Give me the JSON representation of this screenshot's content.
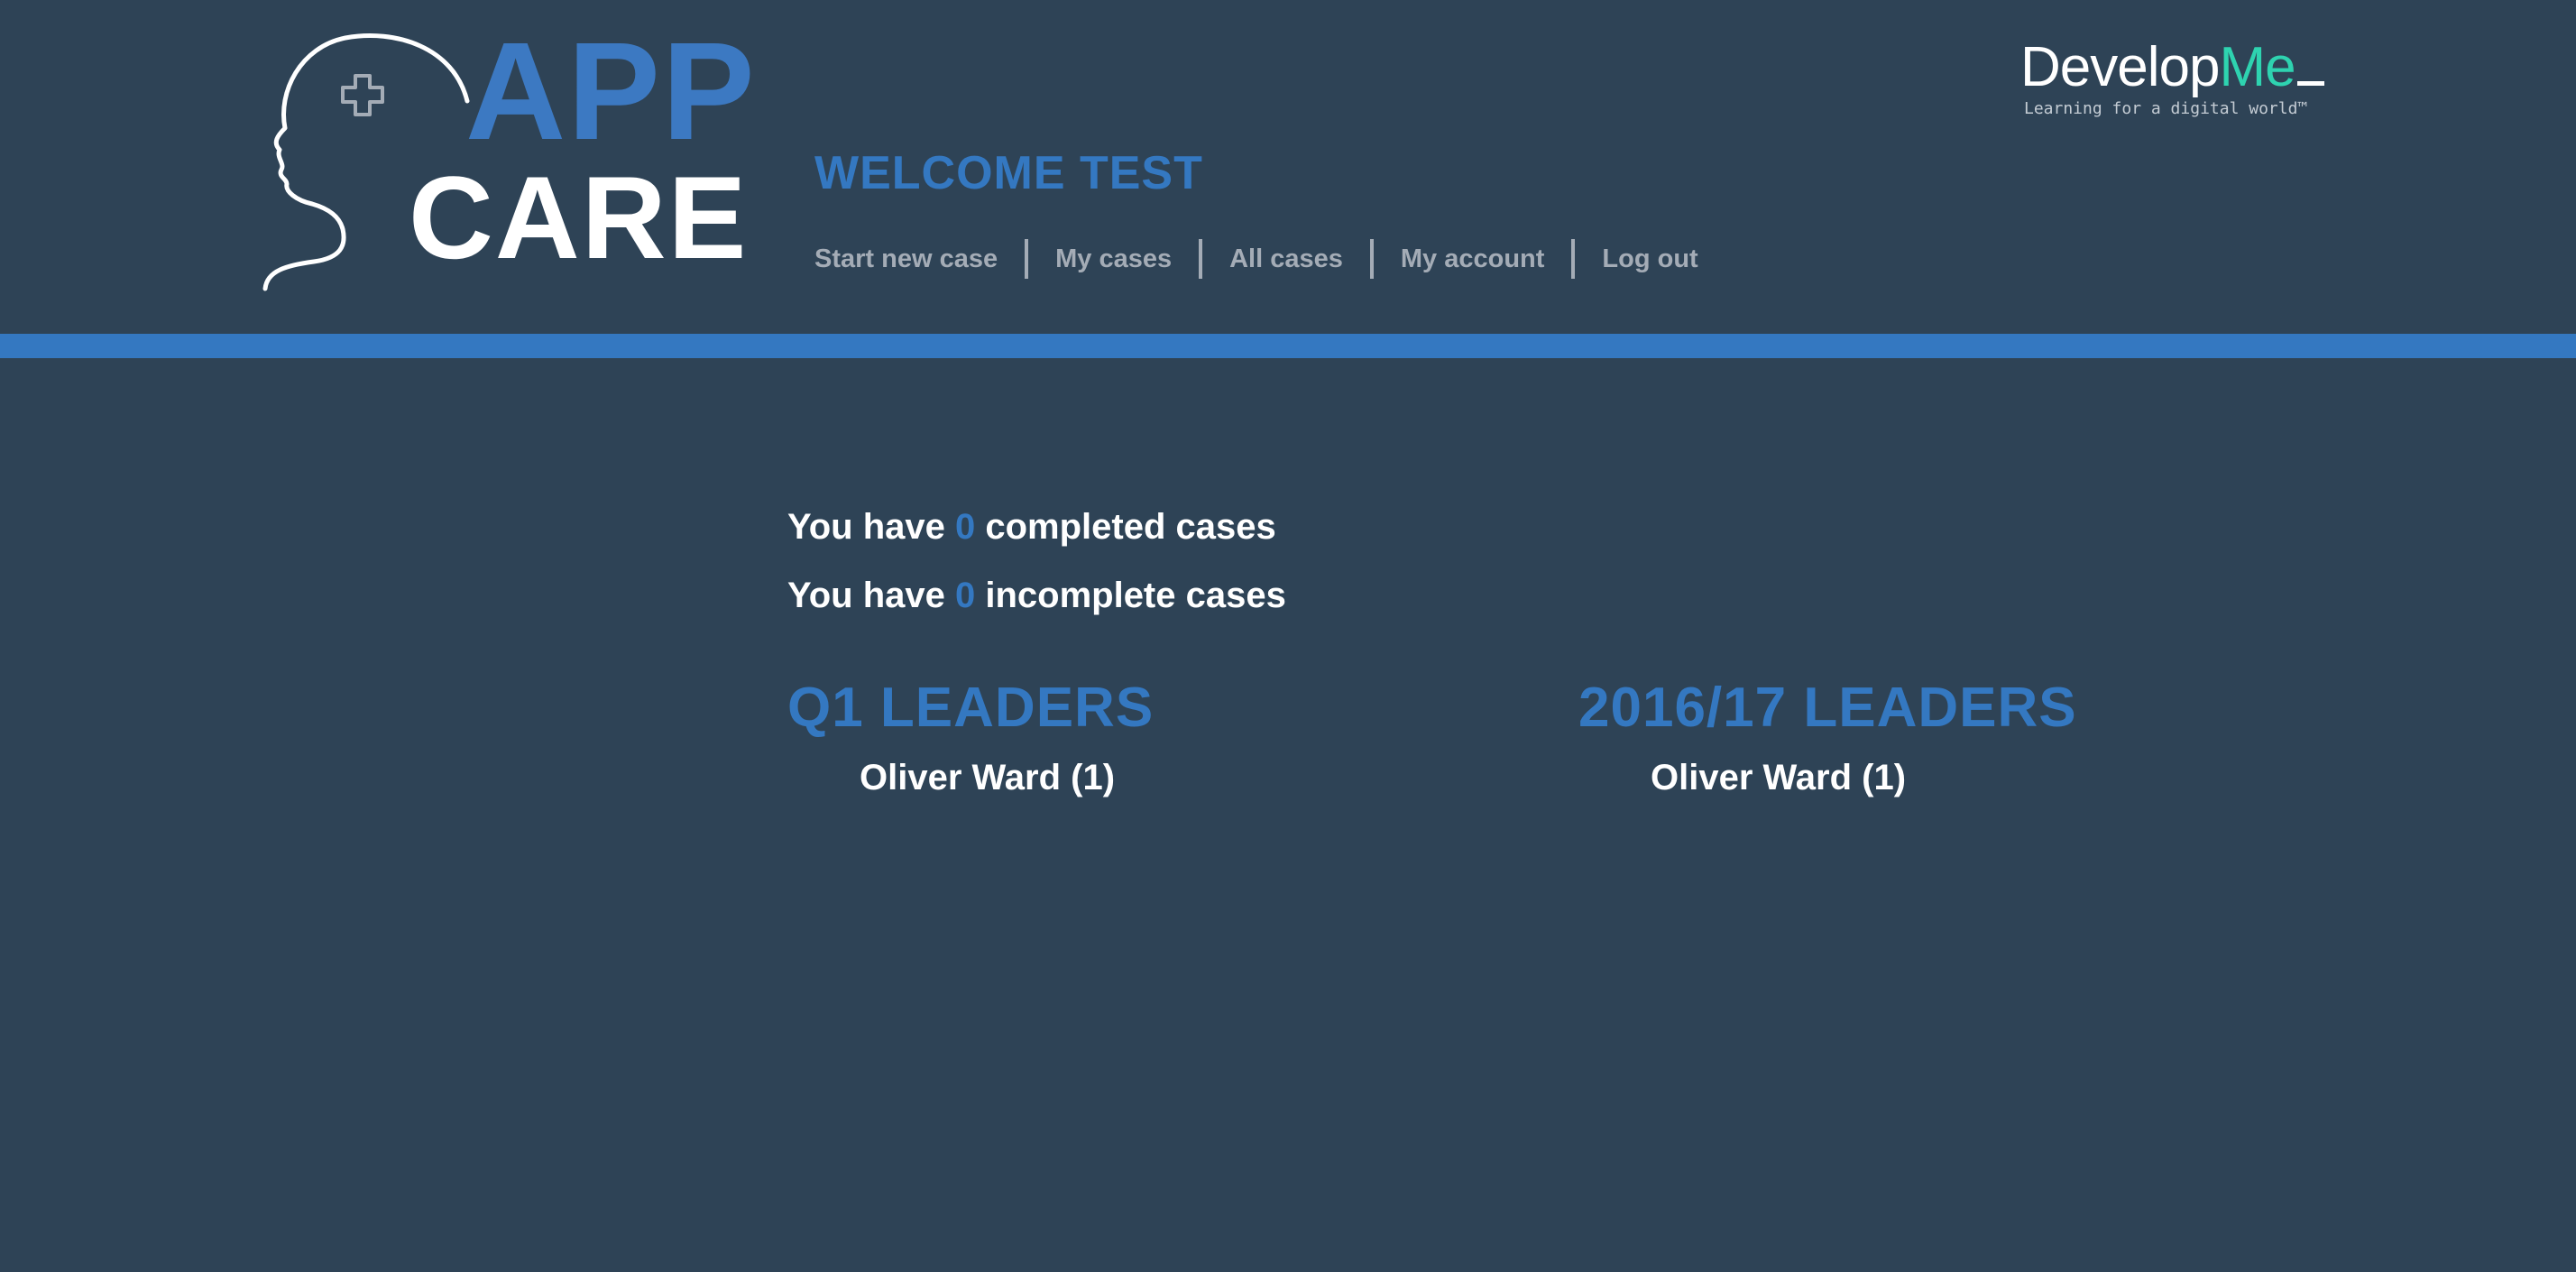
{
  "brand": {
    "logo_app": "APP",
    "logo_care": "CARE",
    "partner_logo_prefix": "Develop",
    "partner_logo_suffix": "Me",
    "partner_tagline": "Learning for a digital world™"
  },
  "header": {
    "welcome": "WELCOME TEST"
  },
  "nav": {
    "items": [
      {
        "label": "Start new case"
      },
      {
        "label": "My cases"
      },
      {
        "label": "All cases"
      },
      {
        "label": "My account"
      },
      {
        "label": "Log out"
      }
    ]
  },
  "stats": {
    "completed": {
      "prefix": "You have ",
      "count": "0",
      "suffix": " completed cases"
    },
    "incomplete": {
      "prefix": "You have ",
      "count": "0",
      "suffix": " incomplete cases"
    }
  },
  "leaders": {
    "quarter": {
      "title": "Q1 LEADERS",
      "entries": [
        "Oliver Ward (1)"
      ]
    },
    "year": {
      "title": "2016/17 LEADERS",
      "entries": [
        "Oliver Ward (1)"
      ]
    }
  },
  "colors": {
    "background": "#2e4356",
    "accent": "#3478c1",
    "nav_text": "#a4acb6",
    "partner_accent": "#2ed3b0"
  }
}
